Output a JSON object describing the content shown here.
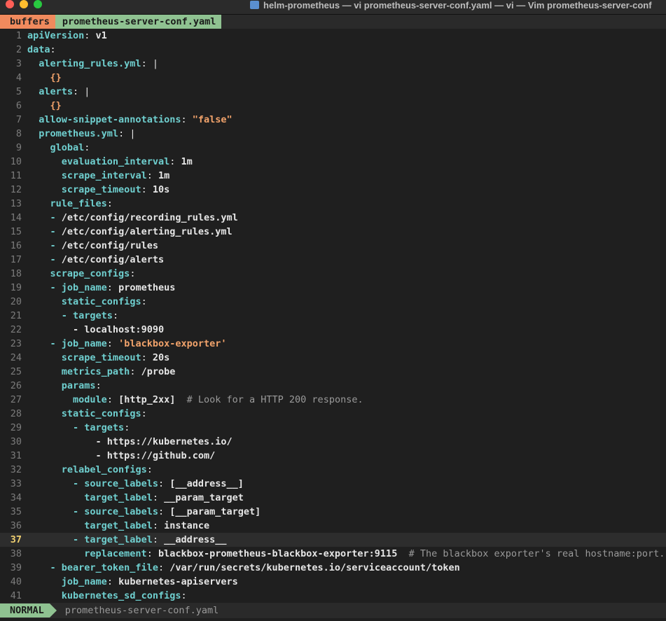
{
  "window": {
    "title": "helm-prometheus — vi prometheus-server-conf.yaml — vi — Vim prometheus-server-conf"
  },
  "tabline": {
    "buffers_label": "buffers",
    "file_tab": "prometheus-server-conf.yaml"
  },
  "statusbar": {
    "mode": "NORMAL",
    "file": "prometheus-server-conf.yaml"
  },
  "colors": {
    "key": "#6fcfcf",
    "string": "#f2a36b",
    "comment": "#9a9a9a",
    "mode_bg": "#8fc291",
    "buffers_bg": "#f08a5d"
  },
  "cursor_line": 37,
  "lines": [
    [
      {
        "t": "k",
        "v": "apiVersion"
      },
      {
        "t": "p",
        "v": ": "
      },
      {
        "t": "v",
        "v": "v1"
      }
    ],
    [
      {
        "t": "k",
        "v": "data"
      },
      {
        "t": "p",
        "v": ":"
      }
    ],
    [
      {
        "t": "p",
        "v": "  "
      },
      {
        "t": "k",
        "v": "alerting_rules.yml"
      },
      {
        "t": "p",
        "v": ": |"
      }
    ],
    [
      {
        "t": "p",
        "v": "    "
      },
      {
        "t": "s",
        "v": "{}"
      }
    ],
    [
      {
        "t": "p",
        "v": "  "
      },
      {
        "t": "k",
        "v": "alerts"
      },
      {
        "t": "p",
        "v": ": |"
      }
    ],
    [
      {
        "t": "p",
        "v": "    "
      },
      {
        "t": "s",
        "v": "{}"
      }
    ],
    [
      {
        "t": "p",
        "v": "  "
      },
      {
        "t": "k",
        "v": "allow-snippet-annotations"
      },
      {
        "t": "p",
        "v": ": "
      },
      {
        "t": "s",
        "v": "\"false\""
      }
    ],
    [
      {
        "t": "p",
        "v": "  "
      },
      {
        "t": "k",
        "v": "prometheus.yml"
      },
      {
        "t": "p",
        "v": ": |"
      }
    ],
    [
      {
        "t": "p",
        "v": "    "
      },
      {
        "t": "k",
        "v": "global"
      },
      {
        "t": "p",
        "v": ":"
      }
    ],
    [
      {
        "t": "p",
        "v": "      "
      },
      {
        "t": "k",
        "v": "evaluation_interval"
      },
      {
        "t": "p",
        "v": ": "
      },
      {
        "t": "v",
        "v": "1m"
      }
    ],
    [
      {
        "t": "p",
        "v": "      "
      },
      {
        "t": "k",
        "v": "scrape_interval"
      },
      {
        "t": "p",
        "v": ": "
      },
      {
        "t": "v",
        "v": "1m"
      }
    ],
    [
      {
        "t": "p",
        "v": "      "
      },
      {
        "t": "k",
        "v": "scrape_timeout"
      },
      {
        "t": "p",
        "v": ": "
      },
      {
        "t": "v",
        "v": "10s"
      }
    ],
    [
      {
        "t": "p",
        "v": "    "
      },
      {
        "t": "k",
        "v": "rule_files"
      },
      {
        "t": "p",
        "v": ":"
      }
    ],
    [
      {
        "t": "p",
        "v": "    "
      },
      {
        "t": "k",
        "v": "-"
      },
      {
        "t": "p",
        "v": " "
      },
      {
        "t": "v",
        "v": "/etc/config/recording_rules.yml"
      }
    ],
    [
      {
        "t": "p",
        "v": "    "
      },
      {
        "t": "k",
        "v": "-"
      },
      {
        "t": "p",
        "v": " "
      },
      {
        "t": "v",
        "v": "/etc/config/alerting_rules.yml"
      }
    ],
    [
      {
        "t": "p",
        "v": "    "
      },
      {
        "t": "k",
        "v": "-"
      },
      {
        "t": "p",
        "v": " "
      },
      {
        "t": "v",
        "v": "/etc/config/rules"
      }
    ],
    [
      {
        "t": "p",
        "v": "    "
      },
      {
        "t": "k",
        "v": "-"
      },
      {
        "t": "p",
        "v": " "
      },
      {
        "t": "v",
        "v": "/etc/config/alerts"
      }
    ],
    [
      {
        "t": "p",
        "v": "    "
      },
      {
        "t": "k",
        "v": "scrape_configs"
      },
      {
        "t": "p",
        "v": ":"
      }
    ],
    [
      {
        "t": "p",
        "v": "    "
      },
      {
        "t": "k",
        "v": "- job_name"
      },
      {
        "t": "p",
        "v": ": "
      },
      {
        "t": "v",
        "v": "prometheus"
      }
    ],
    [
      {
        "t": "p",
        "v": "      "
      },
      {
        "t": "k",
        "v": "static_configs"
      },
      {
        "t": "p",
        "v": ":"
      }
    ],
    [
      {
        "t": "p",
        "v": "      "
      },
      {
        "t": "k",
        "v": "- targets"
      },
      {
        "t": "p",
        "v": ":"
      }
    ],
    [
      {
        "t": "p",
        "v": "        "
      },
      {
        "t": "v",
        "v": "- localhost:9090"
      }
    ],
    [
      {
        "t": "p",
        "v": "    "
      },
      {
        "t": "k",
        "v": "- job_name"
      },
      {
        "t": "p",
        "v": ": "
      },
      {
        "t": "s",
        "v": "'blackbox-exporter'"
      }
    ],
    [
      {
        "t": "p",
        "v": "      "
      },
      {
        "t": "k",
        "v": "scrape_timeout"
      },
      {
        "t": "p",
        "v": ": "
      },
      {
        "t": "v",
        "v": "20s"
      }
    ],
    [
      {
        "t": "p",
        "v": "      "
      },
      {
        "t": "k",
        "v": "metrics_path"
      },
      {
        "t": "p",
        "v": ": "
      },
      {
        "t": "v",
        "v": "/probe"
      }
    ],
    [
      {
        "t": "p",
        "v": "      "
      },
      {
        "t": "k",
        "v": "params"
      },
      {
        "t": "p",
        "v": ":"
      }
    ],
    [
      {
        "t": "p",
        "v": "        "
      },
      {
        "t": "k",
        "v": "module"
      },
      {
        "t": "p",
        "v": ": "
      },
      {
        "t": "v",
        "v": "[http_2xx]"
      },
      {
        "t": "p",
        "v": "  "
      },
      {
        "t": "c",
        "v": "# Look for a HTTP 200 response."
      }
    ],
    [
      {
        "t": "p",
        "v": "      "
      },
      {
        "t": "k",
        "v": "static_configs"
      },
      {
        "t": "p",
        "v": ":"
      }
    ],
    [
      {
        "t": "p",
        "v": "        "
      },
      {
        "t": "k",
        "v": "- targets"
      },
      {
        "t": "p",
        "v": ":"
      }
    ],
    [
      {
        "t": "p",
        "v": "            "
      },
      {
        "t": "v",
        "v": "- https://kubernetes.io/"
      }
    ],
    [
      {
        "t": "p",
        "v": "            "
      },
      {
        "t": "v",
        "v": "- https://github.com/"
      }
    ],
    [
      {
        "t": "p",
        "v": "      "
      },
      {
        "t": "k",
        "v": "relabel_configs"
      },
      {
        "t": "p",
        "v": ":"
      }
    ],
    [
      {
        "t": "p",
        "v": "        "
      },
      {
        "t": "k",
        "v": "- source_labels"
      },
      {
        "t": "p",
        "v": ": "
      },
      {
        "t": "v",
        "v": "[__address__]"
      }
    ],
    [
      {
        "t": "p",
        "v": "          "
      },
      {
        "t": "k",
        "v": "target_label"
      },
      {
        "t": "p",
        "v": ": "
      },
      {
        "t": "v",
        "v": "__param_target"
      }
    ],
    [
      {
        "t": "p",
        "v": "        "
      },
      {
        "t": "k",
        "v": "- source_labels"
      },
      {
        "t": "p",
        "v": ": "
      },
      {
        "t": "v",
        "v": "[__param_target]"
      }
    ],
    [
      {
        "t": "p",
        "v": "          "
      },
      {
        "t": "k",
        "v": "target_label"
      },
      {
        "t": "p",
        "v": ": "
      },
      {
        "t": "v",
        "v": "instance"
      }
    ],
    [
      {
        "t": "p",
        "v": "        "
      },
      {
        "t": "k",
        "v": "- target_label"
      },
      {
        "t": "p",
        "v": ": "
      },
      {
        "t": "v",
        "v": "__address__"
      }
    ],
    [
      {
        "t": "p",
        "v": "          "
      },
      {
        "t": "k",
        "v": "replacement"
      },
      {
        "t": "p",
        "v": ": "
      },
      {
        "t": "v",
        "v": "blackbox-prometheus-blackbox-exporter:9115"
      },
      {
        "t": "p",
        "v": "  "
      },
      {
        "t": "c",
        "v": "# The blackbox exporter's real hostname:port."
      }
    ],
    [
      {
        "t": "p",
        "v": "    "
      },
      {
        "t": "k",
        "v": "- bearer_token_file"
      },
      {
        "t": "p",
        "v": ": "
      },
      {
        "t": "v",
        "v": "/var/run/secrets/kubernetes.io/serviceaccount/token"
      }
    ],
    [
      {
        "t": "p",
        "v": "      "
      },
      {
        "t": "k",
        "v": "job_name"
      },
      {
        "t": "p",
        "v": ": "
      },
      {
        "t": "v",
        "v": "kubernetes-apiservers"
      }
    ],
    [
      {
        "t": "p",
        "v": "      "
      },
      {
        "t": "k",
        "v": "kubernetes_sd_configs"
      },
      {
        "t": "p",
        "v": ":"
      }
    ]
  ]
}
